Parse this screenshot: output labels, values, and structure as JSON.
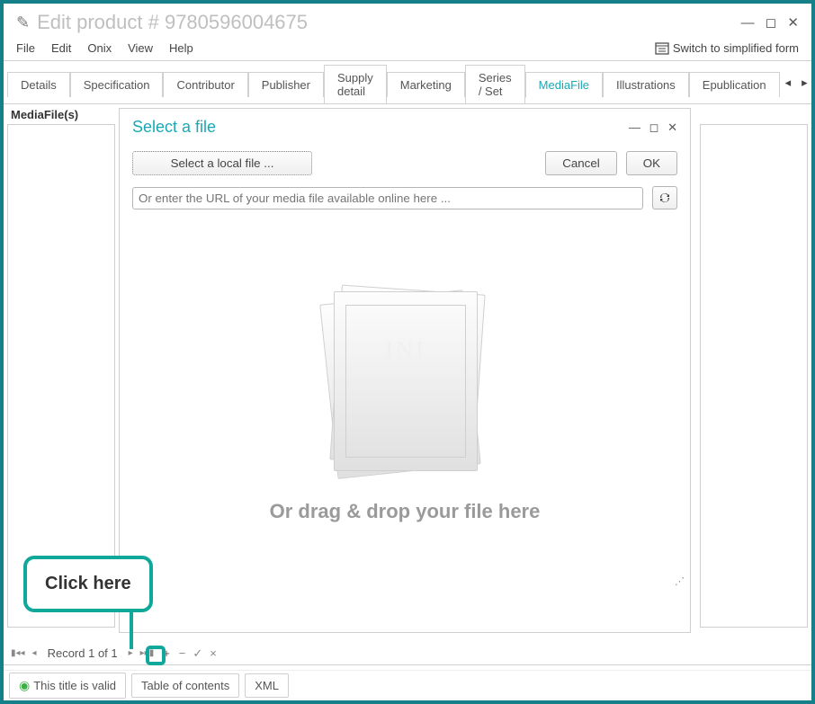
{
  "window": {
    "title": "Edit product # 9780596004675"
  },
  "menu": {
    "file": "File",
    "edit": "Edit",
    "onix": "Onix",
    "view": "View",
    "help": "Help",
    "switch": "Switch to simplified form"
  },
  "tabs": {
    "details": "Details",
    "specification": "Specification",
    "contributor": "Contributor",
    "publisher": "Publisher",
    "supply": "Supply detail",
    "marketing": "Marketing",
    "series": "Series / Set",
    "mediafile": "MediaFile",
    "illustrations": "Illustrations",
    "epublication": "Epublication"
  },
  "sidebar": {
    "label": "MediaFile(s)"
  },
  "dialog": {
    "title": "Select a file",
    "select_local": "Select a local file ...",
    "cancel": "Cancel",
    "ok": "OK",
    "url_placeholder": "Or enter the URL of your media file available online here ...",
    "droptext": "Or drag & drop your file here"
  },
  "callout": {
    "text": "Click here"
  },
  "recordbar": {
    "text": "Record 1 of 1",
    "plus": "+",
    "minus": "−",
    "check": "✓",
    "x": "×"
  },
  "status": {
    "valid": "This title is valid",
    "toc": "Table of contents",
    "xml": "XML"
  }
}
